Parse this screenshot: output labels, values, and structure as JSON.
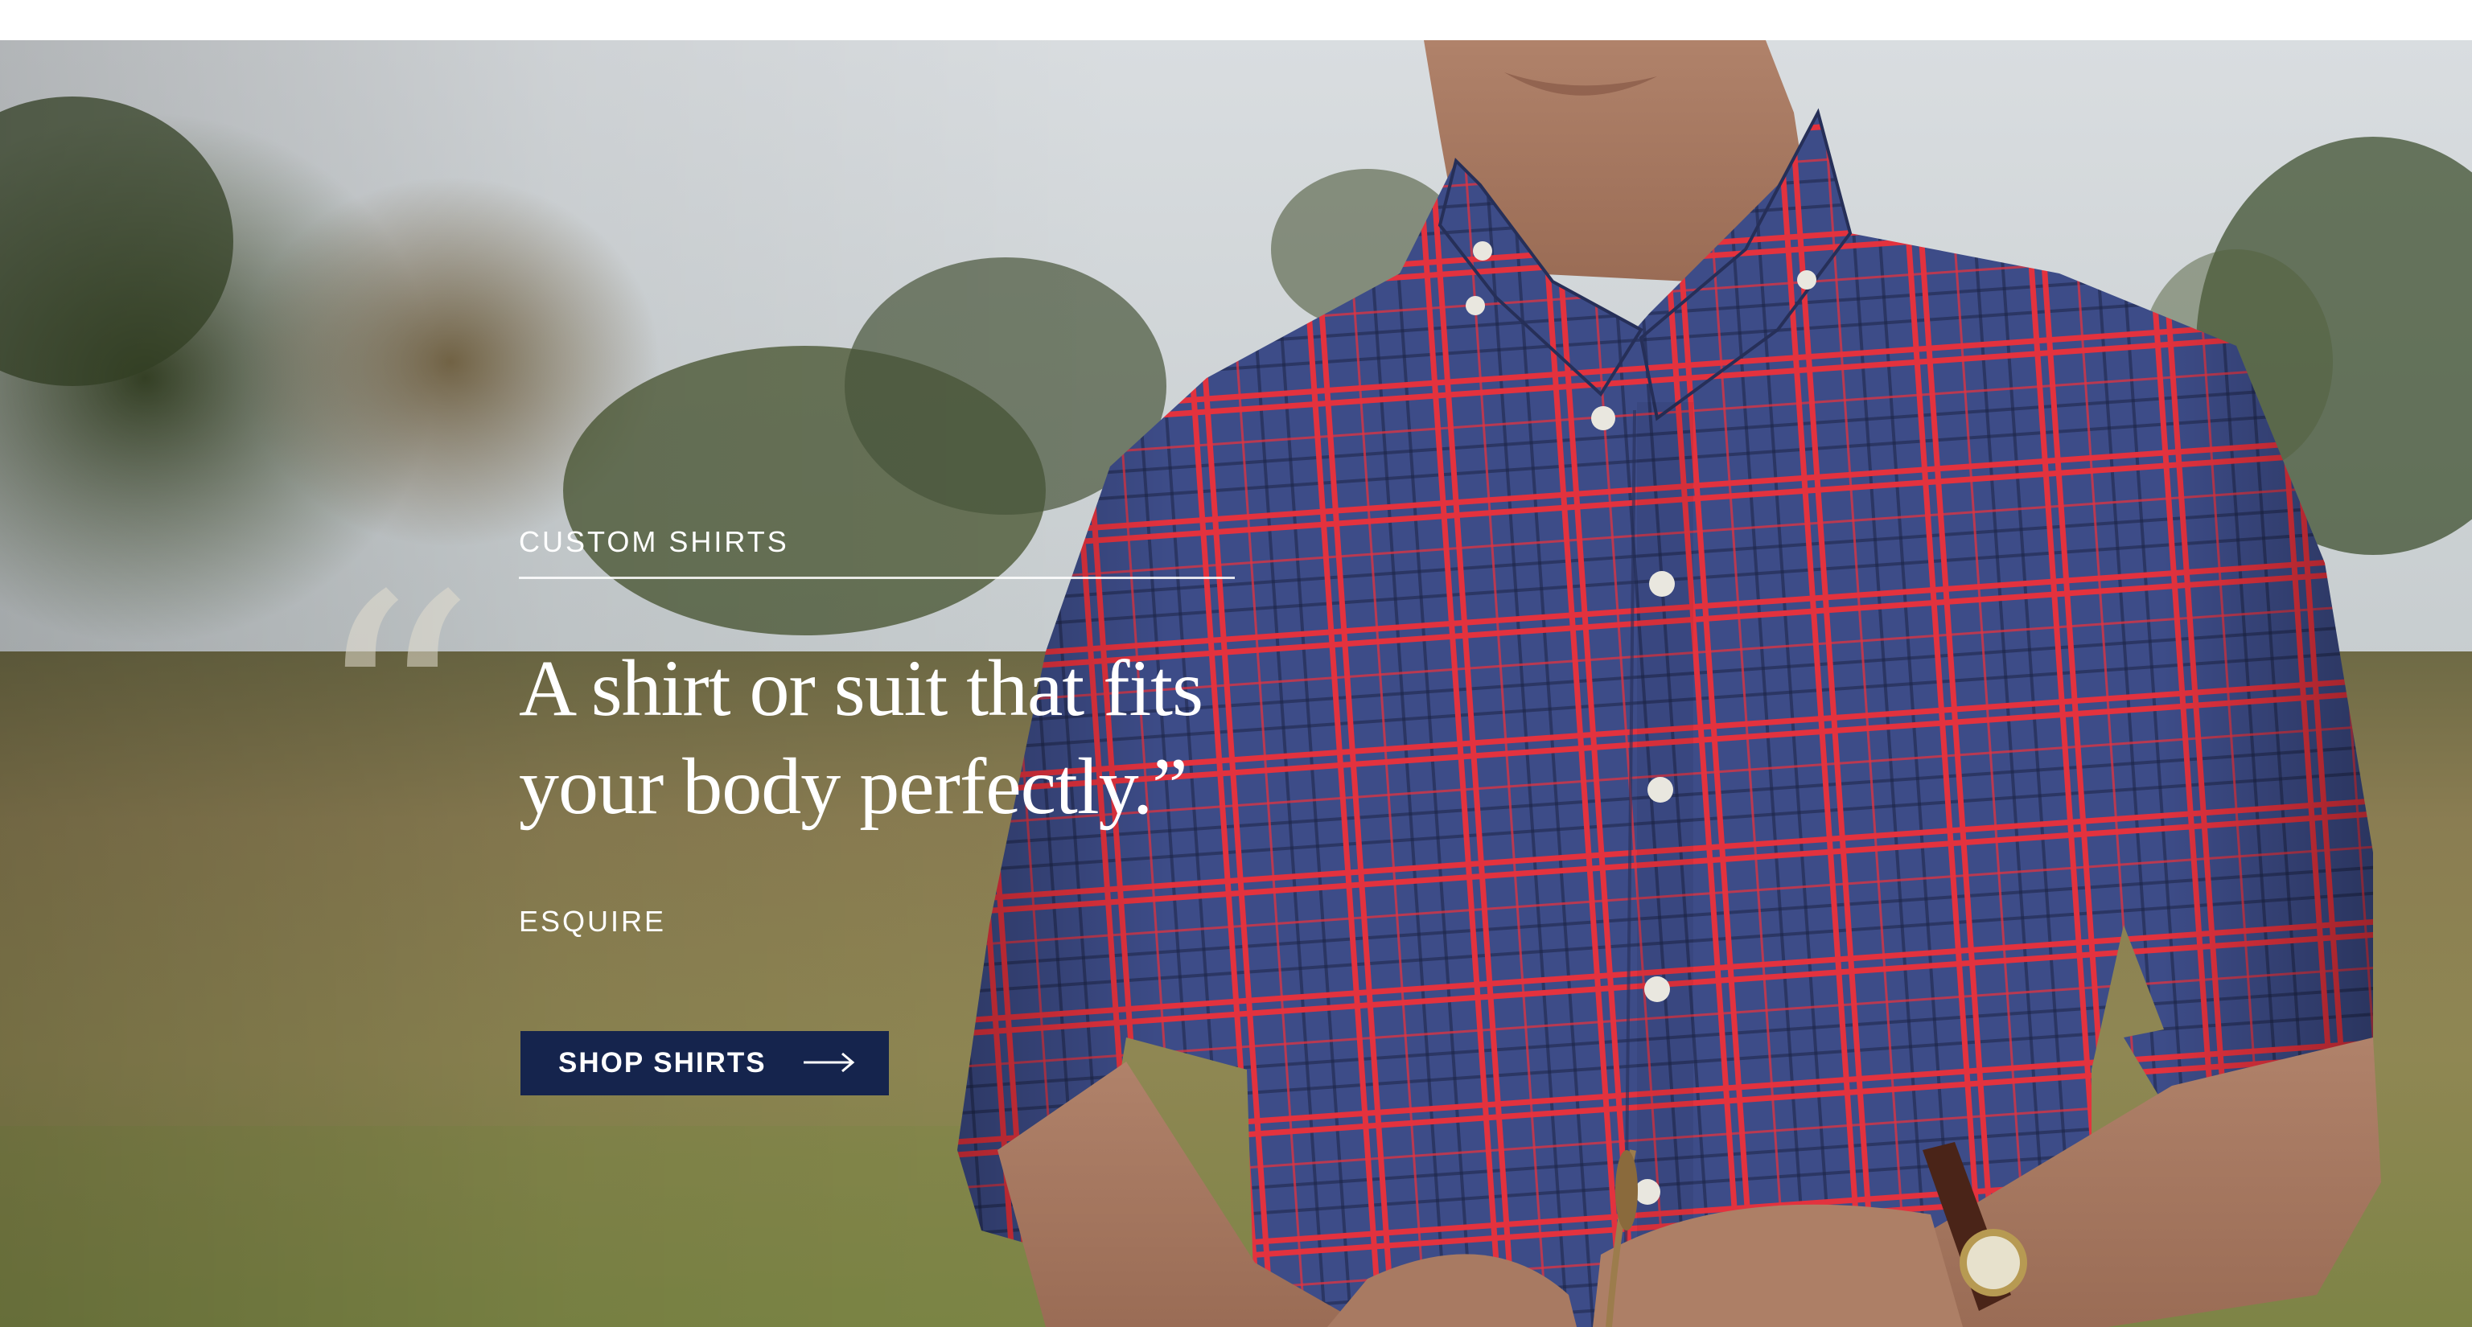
{
  "hero": {
    "eyebrow": "CUSTOM SHIRTS",
    "quote_mark": "“",
    "quote_line_1": "A shirt or suit that fits",
    "quote_line_2": "your body perfectly.”",
    "source": "ESQUIRE",
    "cta_label": "SHOP SHIRTS",
    "cta_icon": "arrow-right-icon"
  },
  "colors": {
    "cta_background": "#15244d",
    "text": "#ffffff",
    "shirt_navy": "#3b4a86",
    "shirt_red": "#e0323f",
    "field": "#8a7f4e"
  }
}
